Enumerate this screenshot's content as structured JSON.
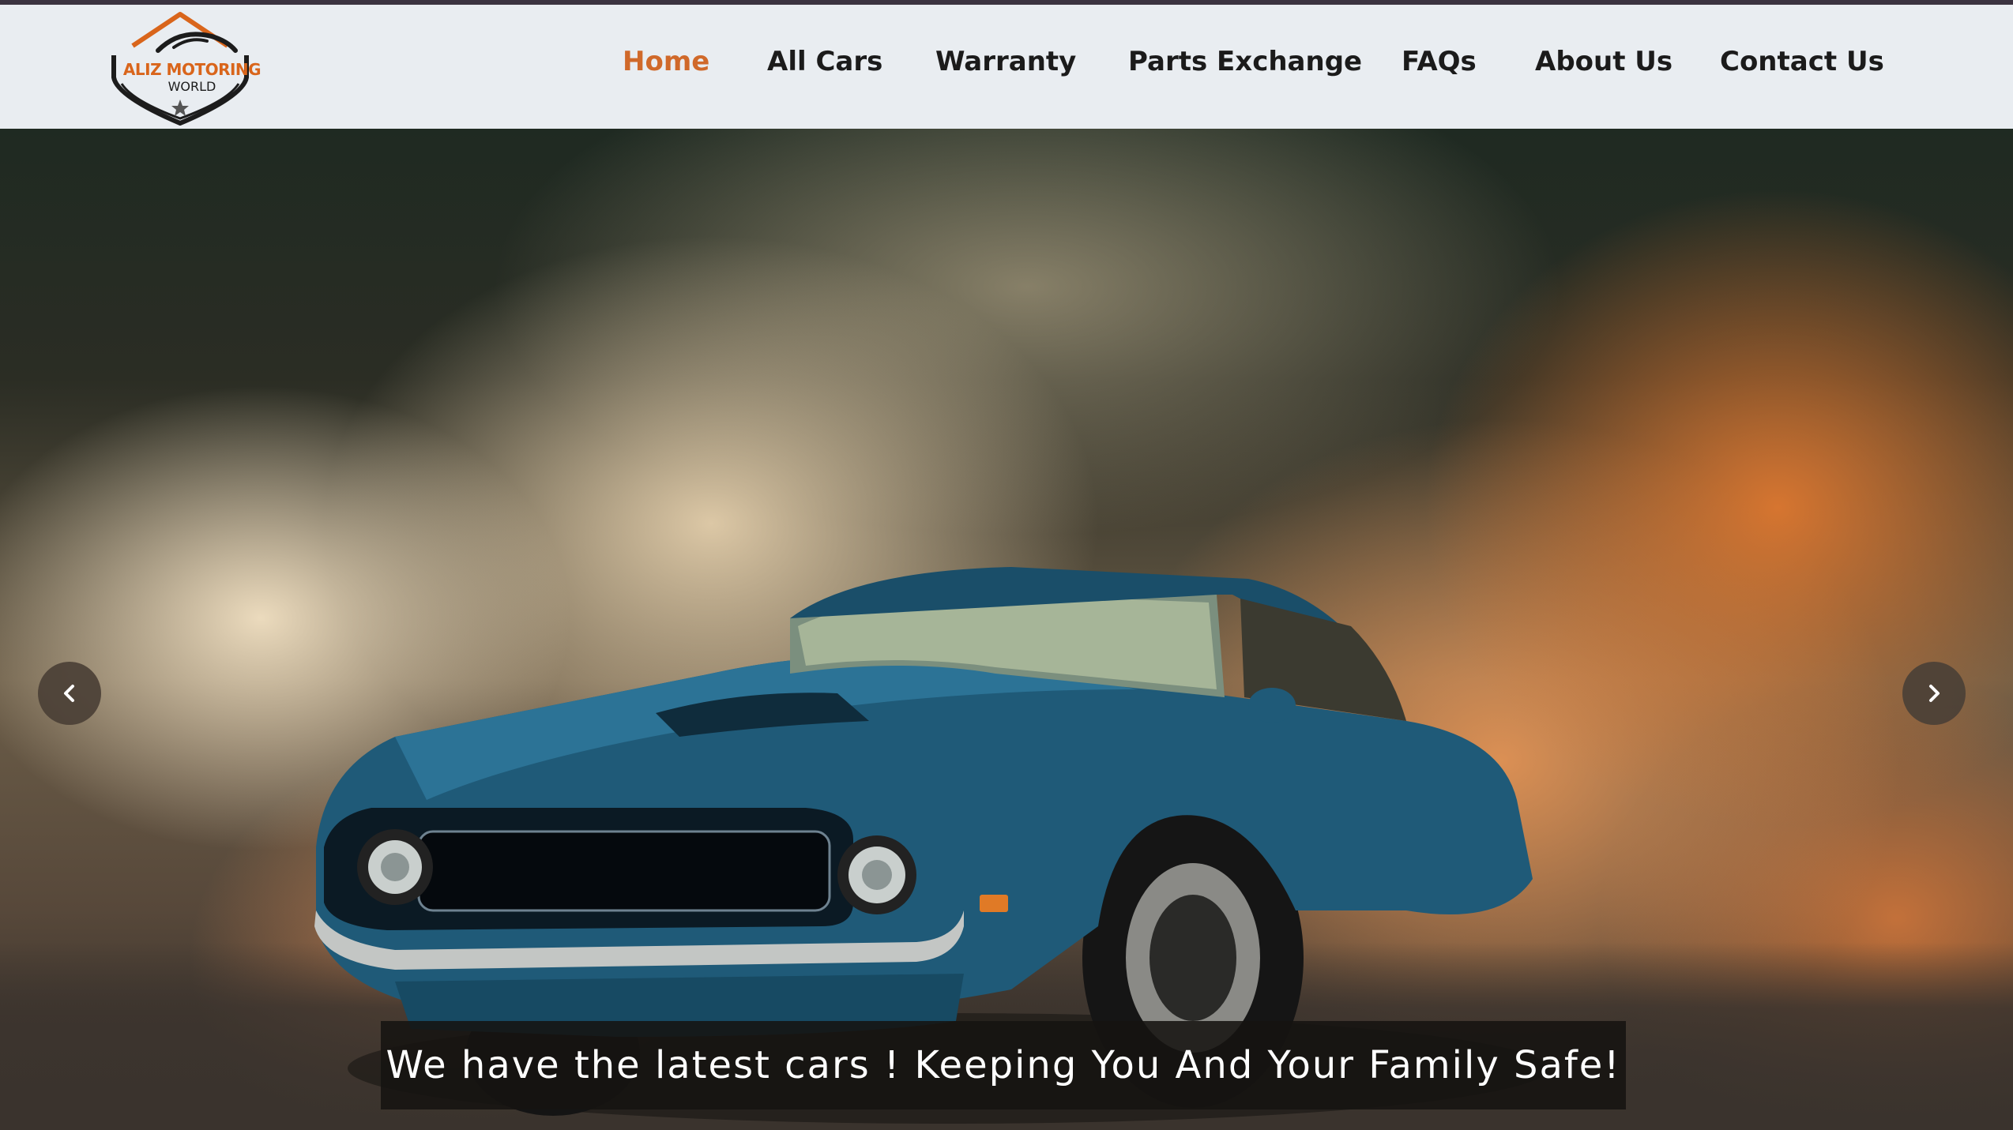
{
  "brand": {
    "name": "ALIZ MOTORING",
    "subname": "WORLD",
    "accent_color": "#d0692a"
  },
  "nav": {
    "items": [
      {
        "label": "Home",
        "active": true
      },
      {
        "label": "All Cars",
        "active": false
      },
      {
        "label": "Warranty",
        "active": false
      },
      {
        "label": "Parts Exchange",
        "active": false
      },
      {
        "label": "FAQs",
        "active": false
      },
      {
        "label": "About Us",
        "active": false
      },
      {
        "label": "Contact Us",
        "active": false
      }
    ]
  },
  "hero": {
    "image": "blue muscle car with tire smoke",
    "prev_icon": "chevron-left-icon",
    "next_icon": "chevron-right-icon",
    "caption": "We have the latest cars ! Keeping You And Your Family Safe!"
  }
}
